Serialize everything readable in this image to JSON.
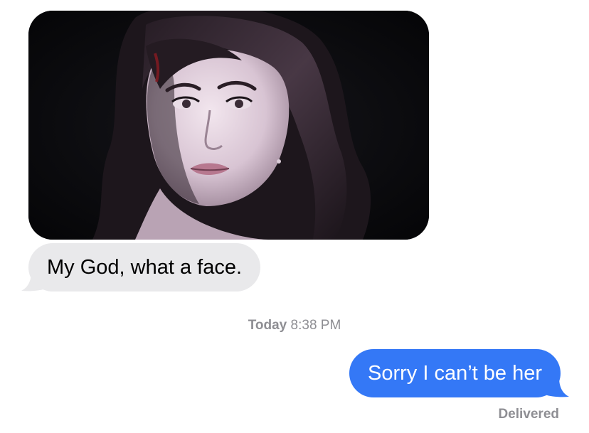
{
  "conversation": {
    "photo": {
      "description": "Photo attachment"
    },
    "incoming_message": {
      "text": "My God, what a face."
    },
    "timestamp": {
      "day": "Today",
      "time": "8:38 PM"
    },
    "outgoing_message": {
      "text": "Sorry I can’t be her"
    },
    "status": "Delivered"
  },
  "colors": {
    "incoming_bubble": "#e9e9eb",
    "outgoing_bubble": "#3478f6",
    "meta_text": "#8e8e93"
  }
}
